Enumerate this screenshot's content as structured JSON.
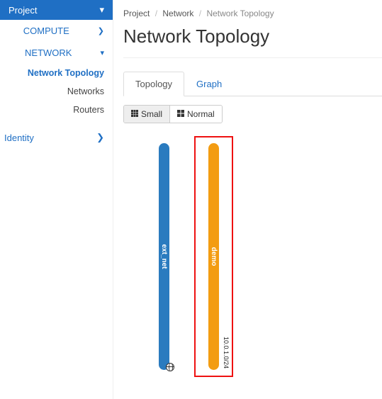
{
  "sidebar": {
    "project_label": "Project",
    "compute_label": "COMPUTE",
    "network_label": "NETWORK",
    "items": {
      "topology": "Network Topology",
      "networks": "Networks",
      "routers": "Routers"
    },
    "identity_label": "Identity"
  },
  "breadcrumb": {
    "a": "Project",
    "b": "Network",
    "c": "Network Topology"
  },
  "page_title": "Network Topology",
  "tabs": {
    "topology": "Topology",
    "graph": "Graph"
  },
  "size_toggle": {
    "small": "Small",
    "normal": "Normal"
  },
  "networks": {
    "ext": {
      "name": "ext_net",
      "color": "#2a7bbf"
    },
    "demo": {
      "name": "demo",
      "color": "#f39c12",
      "cidr": "10.0.1.0/24"
    }
  }
}
